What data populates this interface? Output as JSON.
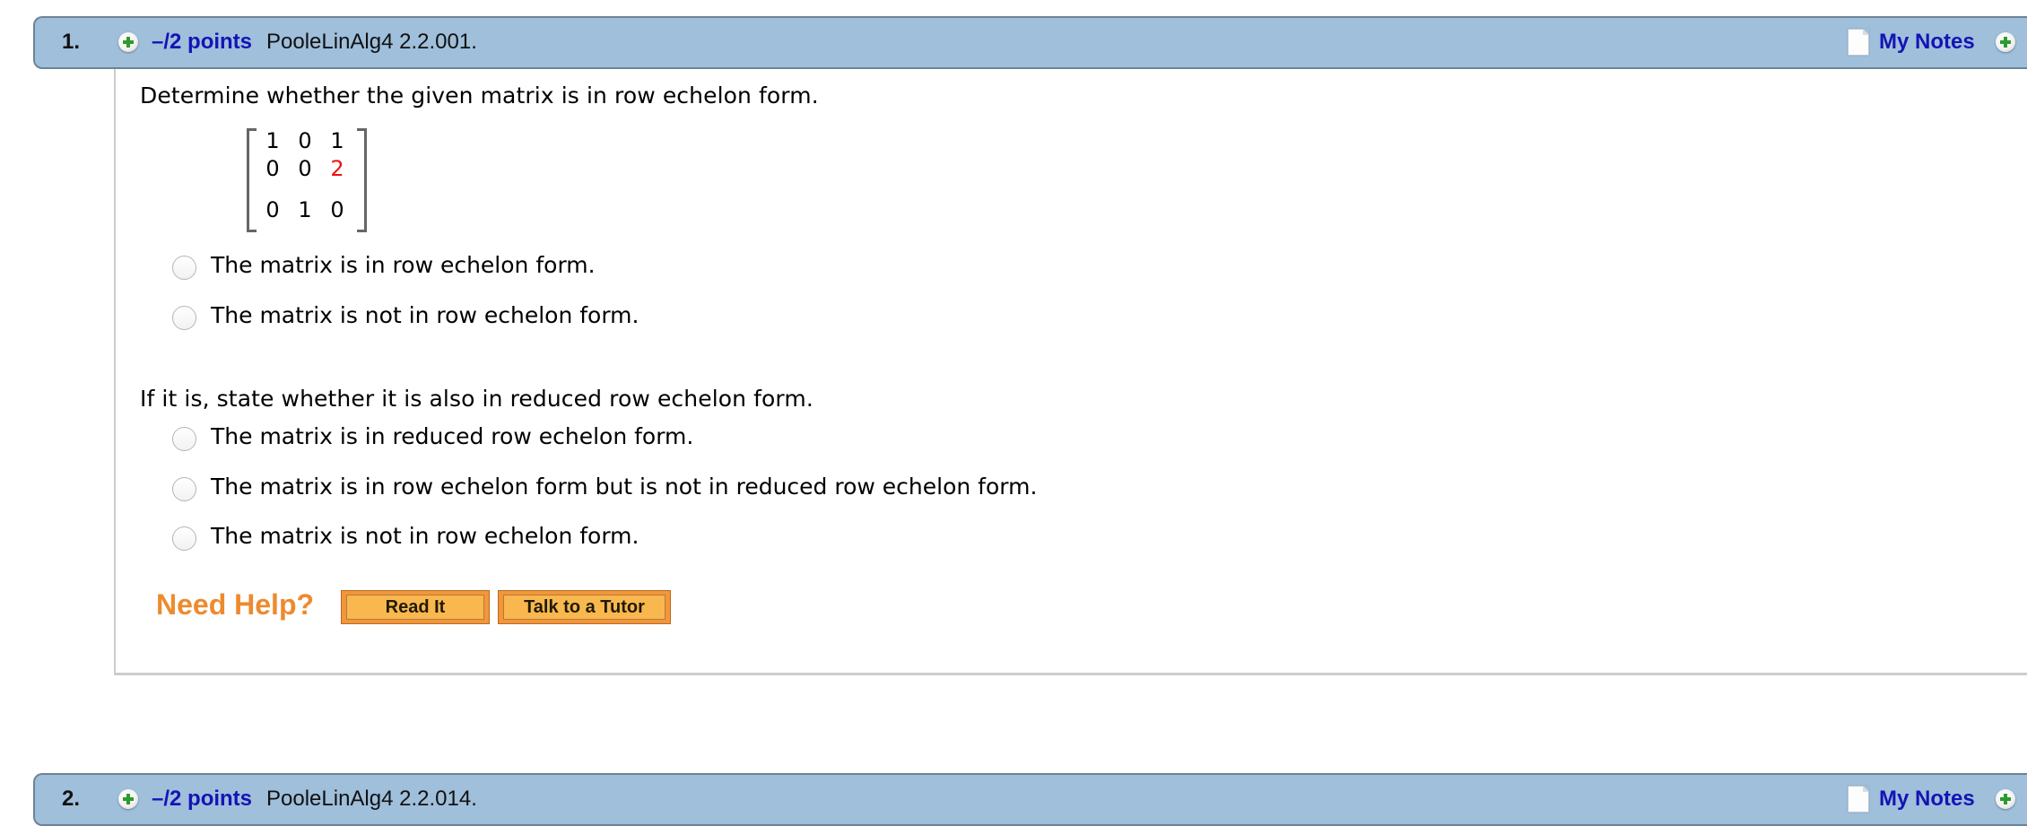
{
  "questions": [
    {
      "number": "1.",
      "points": "–/2 points",
      "code": "PooleLinAlg4 2.2.001.",
      "notes_label": "My Notes",
      "prompt": "Determine whether the given matrix is in row echelon form.",
      "matrix": {
        "rows": [
          [
            "1",
            "0",
            "1"
          ],
          [
            "0",
            "0",
            "2"
          ],
          [
            "0",
            "1",
            "0"
          ]
        ],
        "highlight": {
          "row": 1,
          "col": 2,
          "color": "#ee1111"
        }
      },
      "part1_options": [
        {
          "label": "The matrix is in row echelon form.",
          "selected": false
        },
        {
          "label": "The matrix is not in row echelon form.",
          "selected": false
        }
      ],
      "followup": "If it is, state whether it is also in reduced row echelon form.",
      "part2_options": [
        {
          "label": "The matrix is in reduced row echelon form.",
          "selected": false
        },
        {
          "label": "The matrix is in row echelon form but is not in reduced row echelon form.",
          "selected": false
        },
        {
          "label": "The matrix is not in row echelon form.",
          "selected": false
        }
      ],
      "help": {
        "title": "Need Help?",
        "buttons": [
          "Read It",
          "Talk to a Tutor"
        ]
      }
    },
    {
      "number": "2.",
      "points": "–/2 points",
      "code": "PooleLinAlg4 2.2.014.",
      "notes_label": "My Notes"
    }
  ],
  "colors": {
    "header_bg": "#9fbfdb",
    "header_border": "#6e8396",
    "link_blue": "#1414b4",
    "help_orange": "#ee8a2e",
    "button_orange": "#f8b84f"
  },
  "icons": {
    "add": "plus-circle-icon",
    "notes": "document-icon"
  }
}
